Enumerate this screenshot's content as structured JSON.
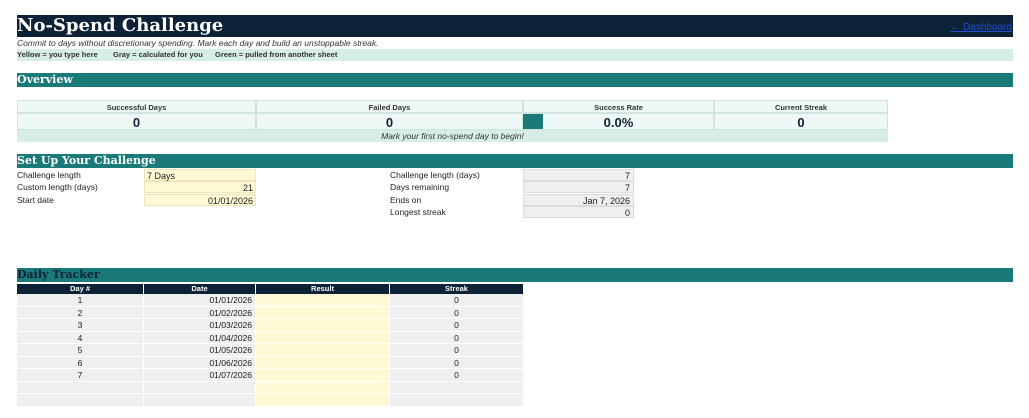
{
  "header": {
    "title": "No-Spend Challenge",
    "dashboard_link": "← Dashboard",
    "subtitle": "Commit to days without discretionary spending. Mark each day and build an unstoppable streak.",
    "legend": [
      "Yellow = you type here",
      "Gray = calculated for you",
      "Green = pulled from another sheet"
    ]
  },
  "overview": {
    "section_title": "Overview",
    "kpis": [
      {
        "label": "Successful Days",
        "value": "0"
      },
      {
        "label": "Failed Days",
        "value": "0"
      },
      {
        "label": "Success Rate",
        "value": "0.0%"
      },
      {
        "label": "Current Streak",
        "value": "0"
      }
    ],
    "message": "Mark your first no-spend day to begin!"
  },
  "setup": {
    "section_title": "Set Up Your Challenge",
    "inputs": [
      {
        "label": "Challenge length",
        "value": "7 Days"
      },
      {
        "label": "Custom length (days)",
        "value": "21"
      },
      {
        "label": "Start date",
        "value": "01/01/2026"
      }
    ],
    "calculated": [
      {
        "label": "Challenge length (days)",
        "value": "7"
      },
      {
        "label": "Days remaining",
        "value": "7"
      },
      {
        "label": "Ends on",
        "value": "Jan 7, 2026"
      },
      {
        "label": "Longest streak",
        "value": "0"
      }
    ]
  },
  "tracker": {
    "section_title": "Daily Tracker",
    "columns": [
      "Day #",
      "Date",
      "Result",
      "Streak"
    ],
    "rows": [
      {
        "day": "1",
        "date": "01/01/2026",
        "result": "",
        "streak": "0"
      },
      {
        "day": "2",
        "date": "01/02/2026",
        "result": "",
        "streak": "0"
      },
      {
        "day": "3",
        "date": "01/03/2026",
        "result": "",
        "streak": "0"
      },
      {
        "day": "4",
        "date": "01/04/2026",
        "result": "",
        "streak": "0"
      },
      {
        "day": "5",
        "date": "01/05/2026",
        "result": "",
        "streak": "0"
      },
      {
        "day": "6",
        "date": "01/06/2026",
        "result": "",
        "streak": "0"
      },
      {
        "day": "7",
        "date": "01/07/2026",
        "result": "",
        "streak": "0"
      },
      {
        "day": "",
        "date": "",
        "result": "",
        "streak": ""
      },
      {
        "day": "",
        "date": "",
        "result": "",
        "streak": ""
      }
    ]
  }
}
